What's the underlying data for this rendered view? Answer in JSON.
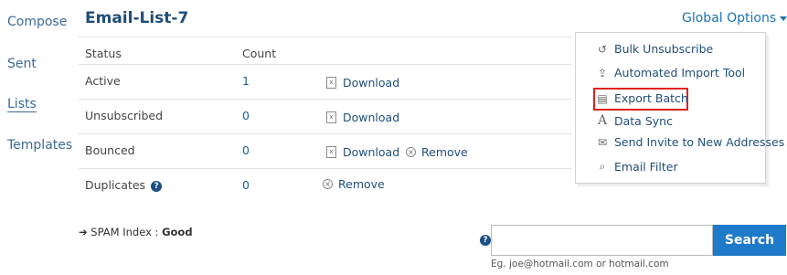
{
  "nav": {
    "items": [
      {
        "label": "Compose"
      },
      {
        "label": "Sent"
      },
      {
        "label": "Lists"
      },
      {
        "label": "Templates"
      }
    ]
  },
  "header": {
    "title": "Email-List-7",
    "global_options": "Global Options"
  },
  "table": {
    "columns": [
      "Status",
      "Count"
    ],
    "rows": [
      {
        "status": "Active",
        "count": "1",
        "download": "Download"
      },
      {
        "status": "Unsubscribed",
        "count": "0",
        "download": "Download"
      },
      {
        "status": "Bounced",
        "count": "0",
        "download": "Download",
        "remove": "Remove"
      },
      {
        "status": "Duplicates",
        "count": "0",
        "remove": "Remove"
      }
    ]
  },
  "dropdown": {
    "items": [
      {
        "label": "Bulk Unsubscribe",
        "icon": "undo-icon"
      },
      {
        "label": "Automated Import Tool",
        "icon": "upload-icon"
      },
      {
        "label": "Export Batch",
        "icon": "document-icon"
      },
      {
        "label": "Data Sync",
        "icon": "font-a-icon"
      },
      {
        "label": "Send Invite to New Addresses",
        "icon": "envelope-icon"
      },
      {
        "label": "Email Filter",
        "icon": "search-icon"
      }
    ]
  },
  "spam": {
    "label": "SPAM Index :",
    "value": "Good"
  },
  "search": {
    "button": "Search",
    "value": "",
    "hint": "Eg. joe@hotmail.com or hotmail.com"
  },
  "colors": {
    "accent": "#1f7bc9",
    "title": "#1f4e79",
    "highlight": "#e0201e"
  }
}
